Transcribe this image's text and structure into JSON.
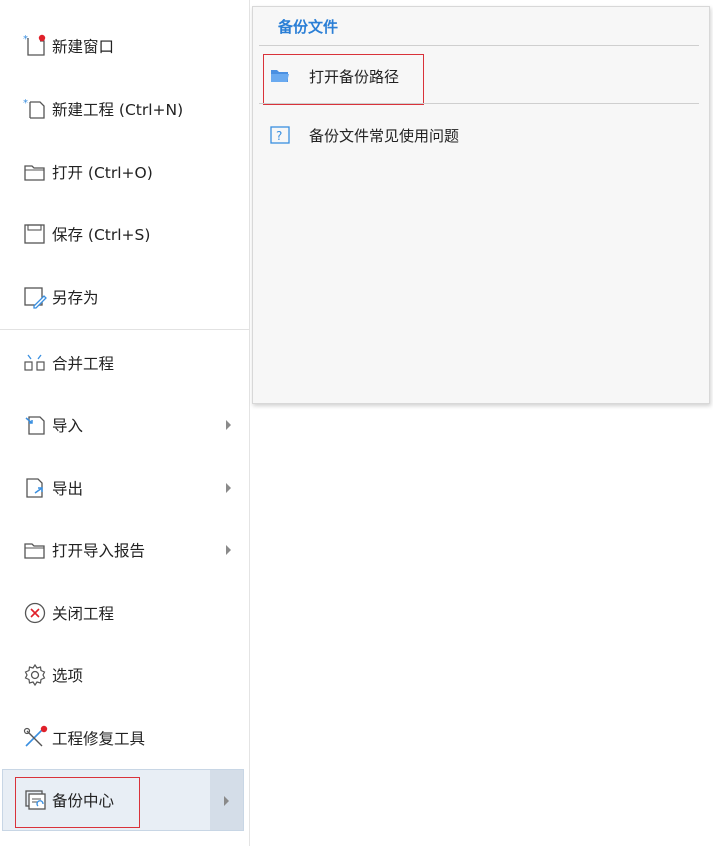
{
  "sidebar": {
    "items": [
      {
        "label": "新建窗口",
        "icon": "new-window-icon"
      },
      {
        "label": "新建工程 (Ctrl+N)",
        "icon": "new-project-icon"
      },
      {
        "label": "打开 (Ctrl+O)",
        "icon": "folder-open-icon"
      },
      {
        "label": "保存 (Ctrl+S)",
        "icon": "save-icon"
      },
      {
        "label": "另存为",
        "icon": "save-as-icon"
      },
      {
        "label": "合并工程",
        "icon": "merge-icon"
      },
      {
        "label": "导入",
        "icon": "import-icon"
      },
      {
        "label": "导出",
        "icon": "export-icon"
      },
      {
        "label": "打开导入报告",
        "icon": "folder-report-icon"
      },
      {
        "label": "关闭工程",
        "icon": "close-circle-icon"
      },
      {
        "label": "选项",
        "icon": "gear-icon"
      },
      {
        "label": "工程修复工具",
        "icon": "repair-tools-icon"
      },
      {
        "label": "备份中心",
        "icon": "backup-center-icon"
      }
    ]
  },
  "submenu": {
    "title": "备份文件",
    "items": [
      {
        "label": "打开备份路径",
        "icon": "folder-icon"
      },
      {
        "label": "备份文件常见使用问题",
        "icon": "help-icon"
      }
    ]
  },
  "colors": {
    "accent": "#2b7fd6",
    "highlight_border": "#d9323a",
    "notification_dot": "#e0202a",
    "selected_bg": "#e8eef5"
  }
}
